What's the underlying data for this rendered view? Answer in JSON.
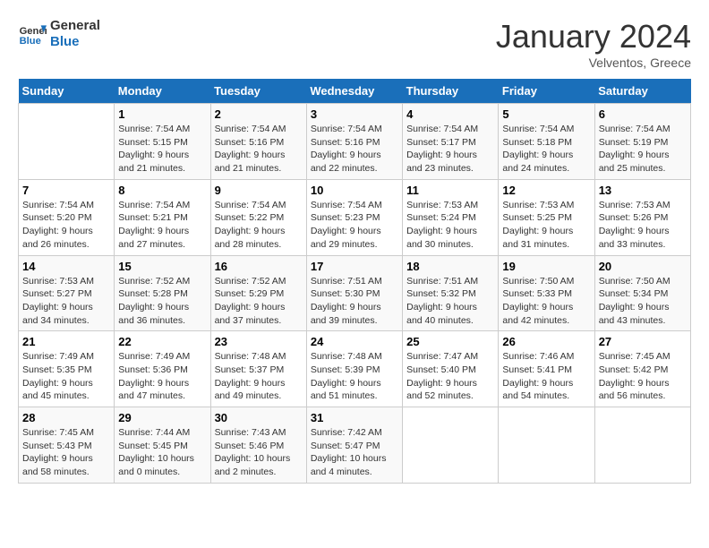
{
  "header": {
    "logo_line1": "General",
    "logo_line2": "Blue",
    "month": "January 2024",
    "location": "Velventos, Greece"
  },
  "weekdays": [
    "Sunday",
    "Monday",
    "Tuesday",
    "Wednesday",
    "Thursday",
    "Friday",
    "Saturday"
  ],
  "weeks": [
    [
      {
        "num": "",
        "info": ""
      },
      {
        "num": "1",
        "info": "Sunrise: 7:54 AM\nSunset: 5:15 PM\nDaylight: 9 hours\nand 21 minutes."
      },
      {
        "num": "2",
        "info": "Sunrise: 7:54 AM\nSunset: 5:16 PM\nDaylight: 9 hours\nand 21 minutes."
      },
      {
        "num": "3",
        "info": "Sunrise: 7:54 AM\nSunset: 5:16 PM\nDaylight: 9 hours\nand 22 minutes."
      },
      {
        "num": "4",
        "info": "Sunrise: 7:54 AM\nSunset: 5:17 PM\nDaylight: 9 hours\nand 23 minutes."
      },
      {
        "num": "5",
        "info": "Sunrise: 7:54 AM\nSunset: 5:18 PM\nDaylight: 9 hours\nand 24 minutes."
      },
      {
        "num": "6",
        "info": "Sunrise: 7:54 AM\nSunset: 5:19 PM\nDaylight: 9 hours\nand 25 minutes."
      }
    ],
    [
      {
        "num": "7",
        "info": "Sunrise: 7:54 AM\nSunset: 5:20 PM\nDaylight: 9 hours\nand 26 minutes."
      },
      {
        "num": "8",
        "info": "Sunrise: 7:54 AM\nSunset: 5:21 PM\nDaylight: 9 hours\nand 27 minutes."
      },
      {
        "num": "9",
        "info": "Sunrise: 7:54 AM\nSunset: 5:22 PM\nDaylight: 9 hours\nand 28 minutes."
      },
      {
        "num": "10",
        "info": "Sunrise: 7:54 AM\nSunset: 5:23 PM\nDaylight: 9 hours\nand 29 minutes."
      },
      {
        "num": "11",
        "info": "Sunrise: 7:53 AM\nSunset: 5:24 PM\nDaylight: 9 hours\nand 30 minutes."
      },
      {
        "num": "12",
        "info": "Sunrise: 7:53 AM\nSunset: 5:25 PM\nDaylight: 9 hours\nand 31 minutes."
      },
      {
        "num": "13",
        "info": "Sunrise: 7:53 AM\nSunset: 5:26 PM\nDaylight: 9 hours\nand 33 minutes."
      }
    ],
    [
      {
        "num": "14",
        "info": "Sunrise: 7:53 AM\nSunset: 5:27 PM\nDaylight: 9 hours\nand 34 minutes."
      },
      {
        "num": "15",
        "info": "Sunrise: 7:52 AM\nSunset: 5:28 PM\nDaylight: 9 hours\nand 36 minutes."
      },
      {
        "num": "16",
        "info": "Sunrise: 7:52 AM\nSunset: 5:29 PM\nDaylight: 9 hours\nand 37 minutes."
      },
      {
        "num": "17",
        "info": "Sunrise: 7:51 AM\nSunset: 5:30 PM\nDaylight: 9 hours\nand 39 minutes."
      },
      {
        "num": "18",
        "info": "Sunrise: 7:51 AM\nSunset: 5:32 PM\nDaylight: 9 hours\nand 40 minutes."
      },
      {
        "num": "19",
        "info": "Sunrise: 7:50 AM\nSunset: 5:33 PM\nDaylight: 9 hours\nand 42 minutes."
      },
      {
        "num": "20",
        "info": "Sunrise: 7:50 AM\nSunset: 5:34 PM\nDaylight: 9 hours\nand 43 minutes."
      }
    ],
    [
      {
        "num": "21",
        "info": "Sunrise: 7:49 AM\nSunset: 5:35 PM\nDaylight: 9 hours\nand 45 minutes."
      },
      {
        "num": "22",
        "info": "Sunrise: 7:49 AM\nSunset: 5:36 PM\nDaylight: 9 hours\nand 47 minutes."
      },
      {
        "num": "23",
        "info": "Sunrise: 7:48 AM\nSunset: 5:37 PM\nDaylight: 9 hours\nand 49 minutes."
      },
      {
        "num": "24",
        "info": "Sunrise: 7:48 AM\nSunset: 5:39 PM\nDaylight: 9 hours\nand 51 minutes."
      },
      {
        "num": "25",
        "info": "Sunrise: 7:47 AM\nSunset: 5:40 PM\nDaylight: 9 hours\nand 52 minutes."
      },
      {
        "num": "26",
        "info": "Sunrise: 7:46 AM\nSunset: 5:41 PM\nDaylight: 9 hours\nand 54 minutes."
      },
      {
        "num": "27",
        "info": "Sunrise: 7:45 AM\nSunset: 5:42 PM\nDaylight: 9 hours\nand 56 minutes."
      }
    ],
    [
      {
        "num": "28",
        "info": "Sunrise: 7:45 AM\nSunset: 5:43 PM\nDaylight: 9 hours\nand 58 minutes."
      },
      {
        "num": "29",
        "info": "Sunrise: 7:44 AM\nSunset: 5:45 PM\nDaylight: 10 hours\nand 0 minutes."
      },
      {
        "num": "30",
        "info": "Sunrise: 7:43 AM\nSunset: 5:46 PM\nDaylight: 10 hours\nand 2 minutes."
      },
      {
        "num": "31",
        "info": "Sunrise: 7:42 AM\nSunset: 5:47 PM\nDaylight: 10 hours\nand 4 minutes."
      },
      {
        "num": "",
        "info": ""
      },
      {
        "num": "",
        "info": ""
      },
      {
        "num": "",
        "info": ""
      }
    ]
  ]
}
